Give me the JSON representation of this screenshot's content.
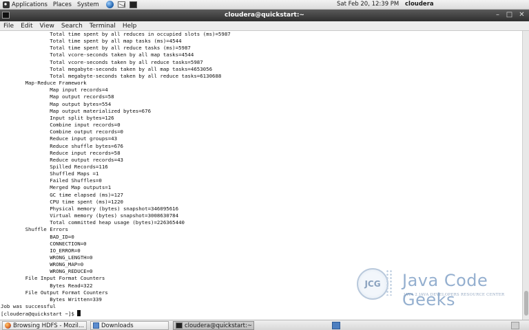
{
  "top_panel": {
    "applications": "Applications",
    "places": "Places",
    "system": "System",
    "icons": [
      "applications-icon",
      "browser-globe-icon",
      "mail-icon",
      "terminal-launcher-icon"
    ],
    "clock": "Sat Feb 20, 12:39 PM",
    "user": "cloudera"
  },
  "window": {
    "title": "cloudera@quickstart:~",
    "controls": {
      "minimize": "–",
      "maximize": "□",
      "close": "✕"
    }
  },
  "menubar": [
    "File",
    "Edit",
    "View",
    "Search",
    "Terminal",
    "Help"
  ],
  "terminal": {
    "lines": [
      "                Total time spent by all reduces in occupied slots (ms)=5987",
      "                Total time spent by all map tasks (ms)=4544",
      "                Total time spent by all reduce tasks (ms)=5987",
      "                Total vcore-seconds taken by all map tasks=4544",
      "                Total vcore-seconds taken by all reduce tasks=5987",
      "                Total megabyte-seconds taken by all map tasks=4653056",
      "                Total megabyte-seconds taken by all reduce tasks=6130688",
      "        Map-Reduce Framework",
      "                Map input records=4",
      "                Map output records=58",
      "                Map output bytes=554",
      "                Map output materialized bytes=676",
      "                Input split bytes=126",
      "                Combine input records=0",
      "                Combine output records=0",
      "                Reduce input groups=43",
      "                Reduce shuffle bytes=676",
      "                Reduce input records=58",
      "                Reduce output records=43",
      "                Spilled Records=116",
      "                Shuffled Maps =1",
      "                Failed Shuffles=0",
      "                Merged Map outputs=1",
      "                GC time elapsed (ms)=127",
      "                CPU time spent (ms)=1220",
      "                Physical memory (bytes) snapshot=346095616",
      "                Virtual memory (bytes) snapshot=3008630784",
      "                Total committed heap usage (bytes)=226365440",
      "        Shuffle Errors",
      "                BAD_ID=0",
      "                CONNECTION=0",
      "                IO_ERROR=0",
      "                WRONG_LENGTH=0",
      "                WRONG_MAP=0",
      "                WRONG_REDUCE=0",
      "        File Input Format Counters ",
      "                Bytes Read=322",
      "        File Output Format Counters ",
      "                Bytes Written=339",
      "Job was successful"
    ],
    "prompt": "[cloudera@quickstart ~]$ "
  },
  "watermark": {
    "logo_text": "JCG",
    "name": "Java Code Geeks",
    "tagline": "JAVA 2 JAVA DEVELOPERS RESOURCE CENTER"
  },
  "taskbar": {
    "tasks": [
      {
        "label": "Browsing HDFS - Mozil...",
        "icon": "firefox-icon",
        "active": false
      },
      {
        "label": "Downloads",
        "icon": "folder-icon",
        "active": false
      },
      {
        "label": "cloudera@quickstart:~",
        "icon": "terminal-icon",
        "active": true
      }
    ]
  }
}
